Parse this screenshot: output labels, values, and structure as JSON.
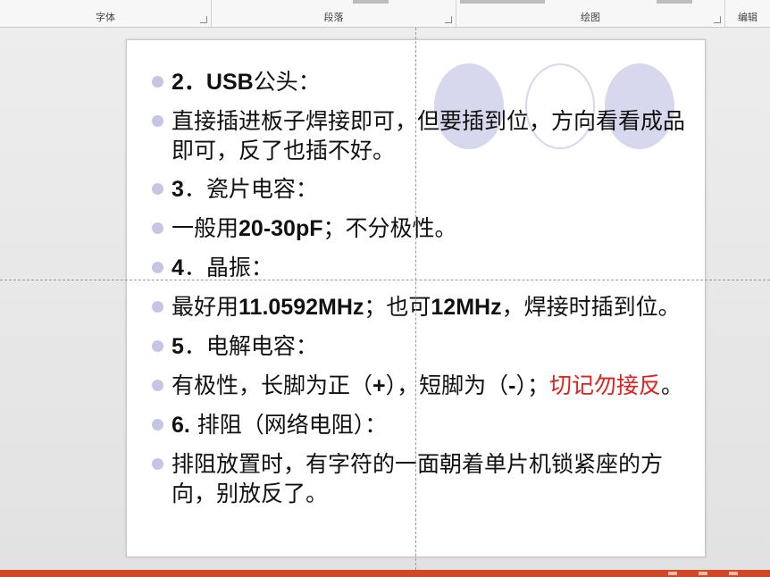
{
  "ribbon": {
    "groups": [
      {
        "label": "字体"
      },
      {
        "label": "段落"
      },
      {
        "label": "绘图"
      },
      {
        "label": "编辑"
      }
    ]
  },
  "slide": {
    "items": [
      {
        "parts": [
          {
            "text": "2．",
            "style": "bold"
          },
          {
            "text": "USB",
            "style": "bold"
          },
          {
            "text": "公头：",
            "style": "normal"
          }
        ]
      },
      {
        "parts": [
          {
            "text": "直接插进板子焊接即可，但要插到位，方向看看成品即可，反了也插不好。",
            "style": "normal"
          }
        ]
      },
      {
        "parts": [
          {
            "text": "3",
            "style": "bold"
          },
          {
            "text": "．瓷片电容：",
            "style": "normal"
          }
        ]
      },
      {
        "parts": [
          {
            "text": "一般用",
            "style": "normal"
          },
          {
            "text": "20-30pF",
            "style": "bold"
          },
          {
            "text": "；不分极性。",
            "style": "normal"
          }
        ]
      },
      {
        "parts": [
          {
            "text": "4",
            "style": "bold"
          },
          {
            "text": "．晶振：",
            "style": "normal"
          }
        ]
      },
      {
        "parts": [
          {
            "text": "最好用",
            "style": "normal"
          },
          {
            "text": "11.0592MHz",
            "style": "bold"
          },
          {
            "text": "；也可",
            "style": "normal"
          },
          {
            "text": "12MHz",
            "style": "bold"
          },
          {
            "text": "，焊接时插到位。",
            "style": "normal"
          }
        ]
      },
      {
        "parts": [
          {
            "text": "5",
            "style": "bold"
          },
          {
            "text": "．电解电容：",
            "style": "normal"
          }
        ]
      },
      {
        "parts": [
          {
            "text": "有极性，长脚为正（",
            "style": "normal"
          },
          {
            "text": "+",
            "style": "bold"
          },
          {
            "text": "），短脚为（",
            "style": "normal"
          },
          {
            "text": "-",
            "style": "bold"
          },
          {
            "text": "）；",
            "style": "normal"
          },
          {
            "text": "切记勿接反",
            "style": "red"
          },
          {
            "text": "。",
            "style": "normal"
          }
        ]
      },
      {
        "parts": [
          {
            "text": "6.",
            "style": "bold"
          },
          {
            "text": " 排阻（网络电阻）：",
            "style": "normal"
          }
        ]
      },
      {
        "parts": [
          {
            "text": "排阻放置时，有字符的一面朝着单片机锁紧座的方向，别放反了。",
            "style": "normal"
          }
        ]
      }
    ]
  },
  "colors": {
    "bullet": "#c5c5e6",
    "accent_red": "#e0201c",
    "taskbar": "#d24726",
    "decoration": "#d7d7ee"
  }
}
